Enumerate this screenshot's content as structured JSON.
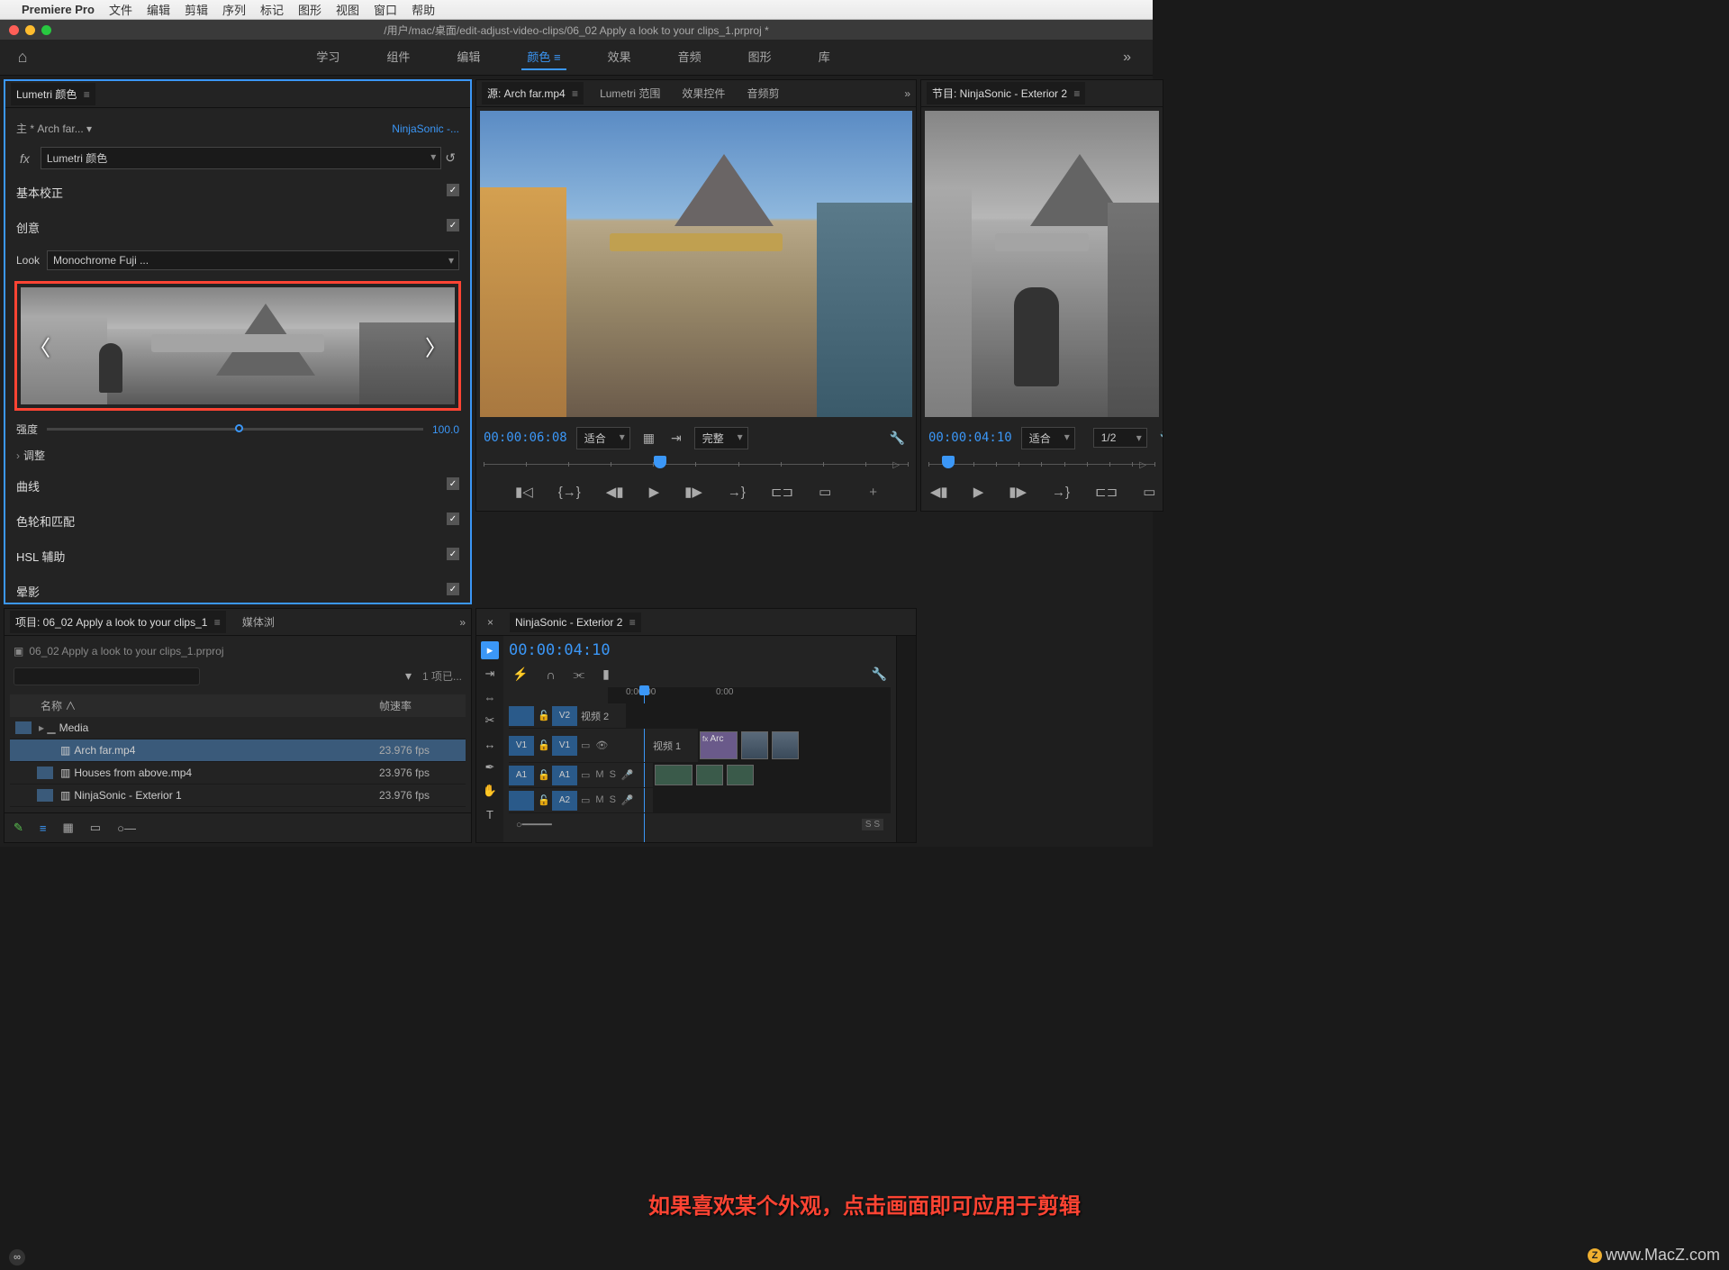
{
  "mac_menu": {
    "apple": "",
    "app": "Premiere Pro",
    "items": [
      "文件",
      "编辑",
      "剪辑",
      "序列",
      "标记",
      "图形",
      "视图",
      "窗口",
      "帮助"
    ]
  },
  "title": "/用户/mac/桌面/edit-adjust-video-clips/06_02 Apply a look to your clips_1.prproj *",
  "workspaces": {
    "home": "⌂",
    "items": [
      "学习",
      "组件",
      "编辑",
      "颜色",
      "效果",
      "音频",
      "图形",
      "库"
    ],
    "active_index": 3
  },
  "source_panel": {
    "tabs": [
      "源: Arch far.mp4",
      "Lumetri 范围",
      "效果控件",
      "音频剪"
    ],
    "active_tab": 0,
    "timecode": "00:00:06:08",
    "fit": "适合",
    "resolution": "完整",
    "scrub_percent": 40
  },
  "program_panel": {
    "title": "节目: NinjaSonic - Exterior 2",
    "timecode": "00:00:04:10",
    "fit": "适合",
    "resolution": "1/2",
    "scrub_percent": 6
  },
  "lumetri": {
    "title": "Lumetri 颜色",
    "clip_master": "主 * Arch far...",
    "sequence_link": "NinjaSonic -...",
    "fx_label": "Lumetri 颜色",
    "sections": {
      "basic": "基本校正",
      "creative": "创意",
      "look_label": "Look",
      "look_value": "Monochrome Fuji ...",
      "intensity_label": "强度",
      "intensity_value": "100.0",
      "adjust": "调整",
      "curves": "曲线",
      "wheels": "色轮和匹配",
      "hsl": "HSL 辅助",
      "vignette": "晕影"
    },
    "callout": "点击"
  },
  "project": {
    "tab": "项目: 06_02 Apply a look to your clips_1",
    "tab2": "媒体浏",
    "filename": "06_02 Apply a look to your clips_1.prproj",
    "count": "1 项已...",
    "headers": {
      "name": "名称",
      "fps": "帧速率"
    },
    "rows": [
      {
        "indent": 0,
        "type": "bin",
        "name": "Media",
        "fps": ""
      },
      {
        "indent": 1,
        "type": "clip",
        "name": "Arch far.mp4",
        "fps": "23.976 fps",
        "selected": true
      },
      {
        "indent": 1,
        "type": "clip",
        "name": "Houses from above.mp4",
        "fps": "23.976 fps"
      },
      {
        "indent": 1,
        "type": "clip",
        "name": "NinjaSonic - Exterior 1",
        "fps": "23.976 fps"
      }
    ]
  },
  "timeline": {
    "tab": "NinjaSonic - Exterior 2",
    "timecode": "00:00:04:10",
    "ruler": [
      "0:00:00",
      "0:00"
    ],
    "tracks": {
      "v2": {
        "src": "",
        "tgt": "V2",
        "label": "视频 2"
      },
      "v1": {
        "src": "V1",
        "tgt": "V1",
        "label": "视频 1"
      },
      "a1": {
        "src": "A1",
        "tgt": "A1",
        "label": ""
      },
      "a2": {
        "src": "",
        "tgt": "A2",
        "label": ""
      }
    },
    "clip_label": "Arc",
    "ss": "S S"
  },
  "overlay_text": "如果喜欢某个外观，点击画面即可应用于剪辑",
  "watermark": "www.MacZ.com"
}
